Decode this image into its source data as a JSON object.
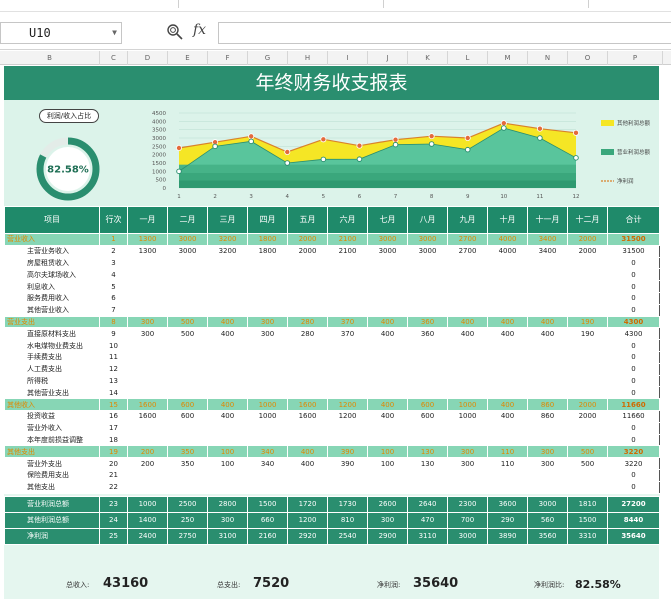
{
  "formula_bar": {
    "cell_ref": "U10",
    "fx": "fx",
    "formula": ""
  },
  "columns": [
    "B",
    "C",
    "D",
    "E",
    "F",
    "G",
    "H",
    "I",
    "J",
    "K",
    "L",
    "M",
    "N",
    "O",
    "P"
  ],
  "report": {
    "title": "年终财务收支报表",
    "ratio_button": "利润/收入占比",
    "ratio_value": "82.58%",
    "ratio_fraction": 0.8258
  },
  "chart_data": {
    "type": "area",
    "x": [
      1,
      2,
      3,
      4,
      5,
      6,
      7,
      8,
      9,
      10,
      11,
      12
    ],
    "yticks": [
      0,
      500,
      1000,
      1500,
      2000,
      2500,
      3000,
      3500,
      4000,
      4500
    ],
    "ylim": [
      0,
      4500
    ],
    "grid": true,
    "legend_position": "right",
    "series": [
      {
        "name": "其他利润总额",
        "color": "#f5e625",
        "values": [
          2400,
          2750,
          3100,
          2160,
          2920,
          2540,
          2900,
          3110,
          3000,
          3890,
          3560,
          3310
        ]
      },
      {
        "name": "营业利润总额",
        "color": "#59c59c",
        "values": [
          1000,
          2500,
          2800,
          1500,
          1720,
          1730,
          2600,
          2640,
          2300,
          3600,
          3000,
          1810
        ]
      },
      {
        "name": "净利润",
        "color": "#d9822b",
        "values": [
          2400,
          2750,
          3100,
          2160,
          2920,
          2540,
          2900,
          3110,
          3000,
          3890,
          3560,
          3310
        ]
      }
    ],
    "white_points": [
      1000,
      2500,
      2800,
      1500,
      1720,
      1730,
      2600,
      2640,
      2300,
      3600,
      3000,
      1810
    ]
  },
  "table": {
    "headers": [
      "项目",
      "行次",
      "一月",
      "二月",
      "三月",
      "四月",
      "五月",
      "六月",
      "七月",
      "八月",
      "九月",
      "十月",
      "十一月",
      "十二月",
      "合计"
    ],
    "rows": [
      {
        "kind": "cat",
        "cells": [
          "营业收入",
          "1",
          "1300",
          "3000",
          "3200",
          "1800",
          "2000",
          "2100",
          "3000",
          "3000",
          "2700",
          "4000",
          "3400",
          "2000",
          "31500"
        ]
      },
      {
        "kind": "sub",
        "cells": [
          "主营业务收入",
          "2",
          "1300",
          "3000",
          "3200",
          "1800",
          "2000",
          "2100",
          "3000",
          "3000",
          "2700",
          "4000",
          "3400",
          "2000",
          "31500"
        ]
      },
      {
        "kind": "sub",
        "cells": [
          "房屋租赁收入",
          "3",
          "",
          "",
          "",
          "",
          "",
          "",
          "",
          "",
          "",
          "",
          "",
          "",
          "0"
        ]
      },
      {
        "kind": "sub",
        "cells": [
          "高尔夫球场收入",
          "4",
          "",
          "",
          "",
          "",
          "",
          "",
          "",
          "",
          "",
          "",
          "",
          "",
          "0"
        ]
      },
      {
        "kind": "sub",
        "cells": [
          "利息收入",
          "5",
          "",
          "",
          "",
          "",
          "",
          "",
          "",
          "",
          "",
          "",
          "",
          "",
          "0"
        ]
      },
      {
        "kind": "sub",
        "cells": [
          "服务费用收入",
          "6",
          "",
          "",
          "",
          "",
          "",
          "",
          "",
          "",
          "",
          "",
          "",
          "",
          "0"
        ]
      },
      {
        "kind": "sub",
        "cells": [
          "其他营业收入",
          "7",
          "",
          "",
          "",
          "",
          "",
          "",
          "",
          "",
          "",
          "",
          "",
          "",
          "0"
        ]
      },
      {
        "kind": "cat",
        "cells": [
          "营业支出",
          "8",
          "300",
          "500",
          "400",
          "300",
          "280",
          "370",
          "400",
          "360",
          "400",
          "400",
          "400",
          "190",
          "4300"
        ]
      },
      {
        "kind": "sub",
        "cells": [
          "直接原材料支出",
          "9",
          "300",
          "500",
          "400",
          "300",
          "280",
          "370",
          "400",
          "360",
          "400",
          "400",
          "400",
          "190",
          "4300"
        ]
      },
      {
        "kind": "sub",
        "cells": [
          "水电煤物业费支出",
          "10",
          "",
          "",
          "",
          "",
          "",
          "",
          "",
          "",
          "",
          "",
          "",
          "",
          "0"
        ]
      },
      {
        "kind": "sub",
        "cells": [
          "手续费支出",
          "11",
          "",
          "",
          "",
          "",
          "",
          "",
          "",
          "",
          "",
          "",
          "",
          "",
          "0"
        ]
      },
      {
        "kind": "sub",
        "cells": [
          "人工费支出",
          "12",
          "",
          "",
          "",
          "",
          "",
          "",
          "",
          "",
          "",
          "",
          "",
          "",
          "0"
        ]
      },
      {
        "kind": "sub",
        "cells": [
          "所得税",
          "13",
          "",
          "",
          "",
          "",
          "",
          "",
          "",
          "",
          "",
          "",
          "",
          "",
          "0"
        ]
      },
      {
        "kind": "sub",
        "cells": [
          "其他营业支出",
          "14",
          "",
          "",
          "",
          "",
          "",
          "",
          "",
          "",
          "",
          "",
          "",
          "",
          "0"
        ]
      },
      {
        "kind": "cat",
        "cells": [
          "其他收入",
          "15",
          "1600",
          "600",
          "400",
          "1000",
          "1600",
          "1200",
          "400",
          "600",
          "1000",
          "400",
          "860",
          "2000",
          "11660"
        ]
      },
      {
        "kind": "sub",
        "cells": [
          "投资收益",
          "16",
          "1600",
          "600",
          "400",
          "1000",
          "1600",
          "1200",
          "400",
          "600",
          "1000",
          "400",
          "860",
          "2000",
          "11660"
        ]
      },
      {
        "kind": "sub",
        "cells": [
          "营业外收入",
          "17",
          "",
          "",
          "",
          "",
          "",
          "",
          "",
          "",
          "",
          "",
          "",
          "",
          "0"
        ]
      },
      {
        "kind": "sub",
        "cells": [
          "本年度前损益调整",
          "18",
          "",
          "",
          "",
          "",
          "",
          "",
          "",
          "",
          "",
          "",
          "",
          "",
          "0"
        ]
      },
      {
        "kind": "cat",
        "cells": [
          "其他支出",
          "19",
          "200",
          "350",
          "100",
          "340",
          "400",
          "390",
          "100",
          "130",
          "300",
          "110",
          "300",
          "500",
          "3220"
        ]
      },
      {
        "kind": "sub",
        "cells": [
          "营业外支出",
          "20",
          "200",
          "350",
          "100",
          "340",
          "400",
          "390",
          "100",
          "130",
          "300",
          "110",
          "300",
          "500",
          "3220"
        ]
      },
      {
        "kind": "sub",
        "cells": [
          "保险费用支出",
          "21",
          "",
          "",
          "",
          "",
          "",
          "",
          "",
          "",
          "",
          "",
          "",
          "",
          "0"
        ]
      },
      {
        "kind": "sub",
        "cells": [
          "其他支出",
          "22",
          "",
          "",
          "",
          "",
          "",
          "",
          "",
          "",
          "",
          "",
          "",
          "",
          "0"
        ]
      },
      {
        "kind": "tot",
        "cells": [
          "营业利润总额",
          "23",
          "1000",
          "2500",
          "2800",
          "1500",
          "1720",
          "1730",
          "2600",
          "2640",
          "2300",
          "3600",
          "3000",
          "1810",
          "27200"
        ]
      },
      {
        "kind": "tot",
        "cells": [
          "其他利润总额",
          "24",
          "1400",
          "250",
          "300",
          "660",
          "1200",
          "810",
          "300",
          "470",
          "700",
          "290",
          "560",
          "1500",
          "8440"
        ]
      },
      {
        "kind": "tot",
        "cells": [
          "净利润",
          "25",
          "2400",
          "2750",
          "3100",
          "2160",
          "2920",
          "2540",
          "2900",
          "3110",
          "3000",
          "3890",
          "3560",
          "3310",
          "35640"
        ]
      }
    ]
  },
  "summary": {
    "income_label": "总收入:",
    "income_value": "43160",
    "expense_label": "总支出:",
    "expense_value": "7520",
    "profit_label": "净利润:",
    "profit_value": "35640",
    "ratio_label": "净利润比:",
    "ratio_value": "82.58%"
  }
}
